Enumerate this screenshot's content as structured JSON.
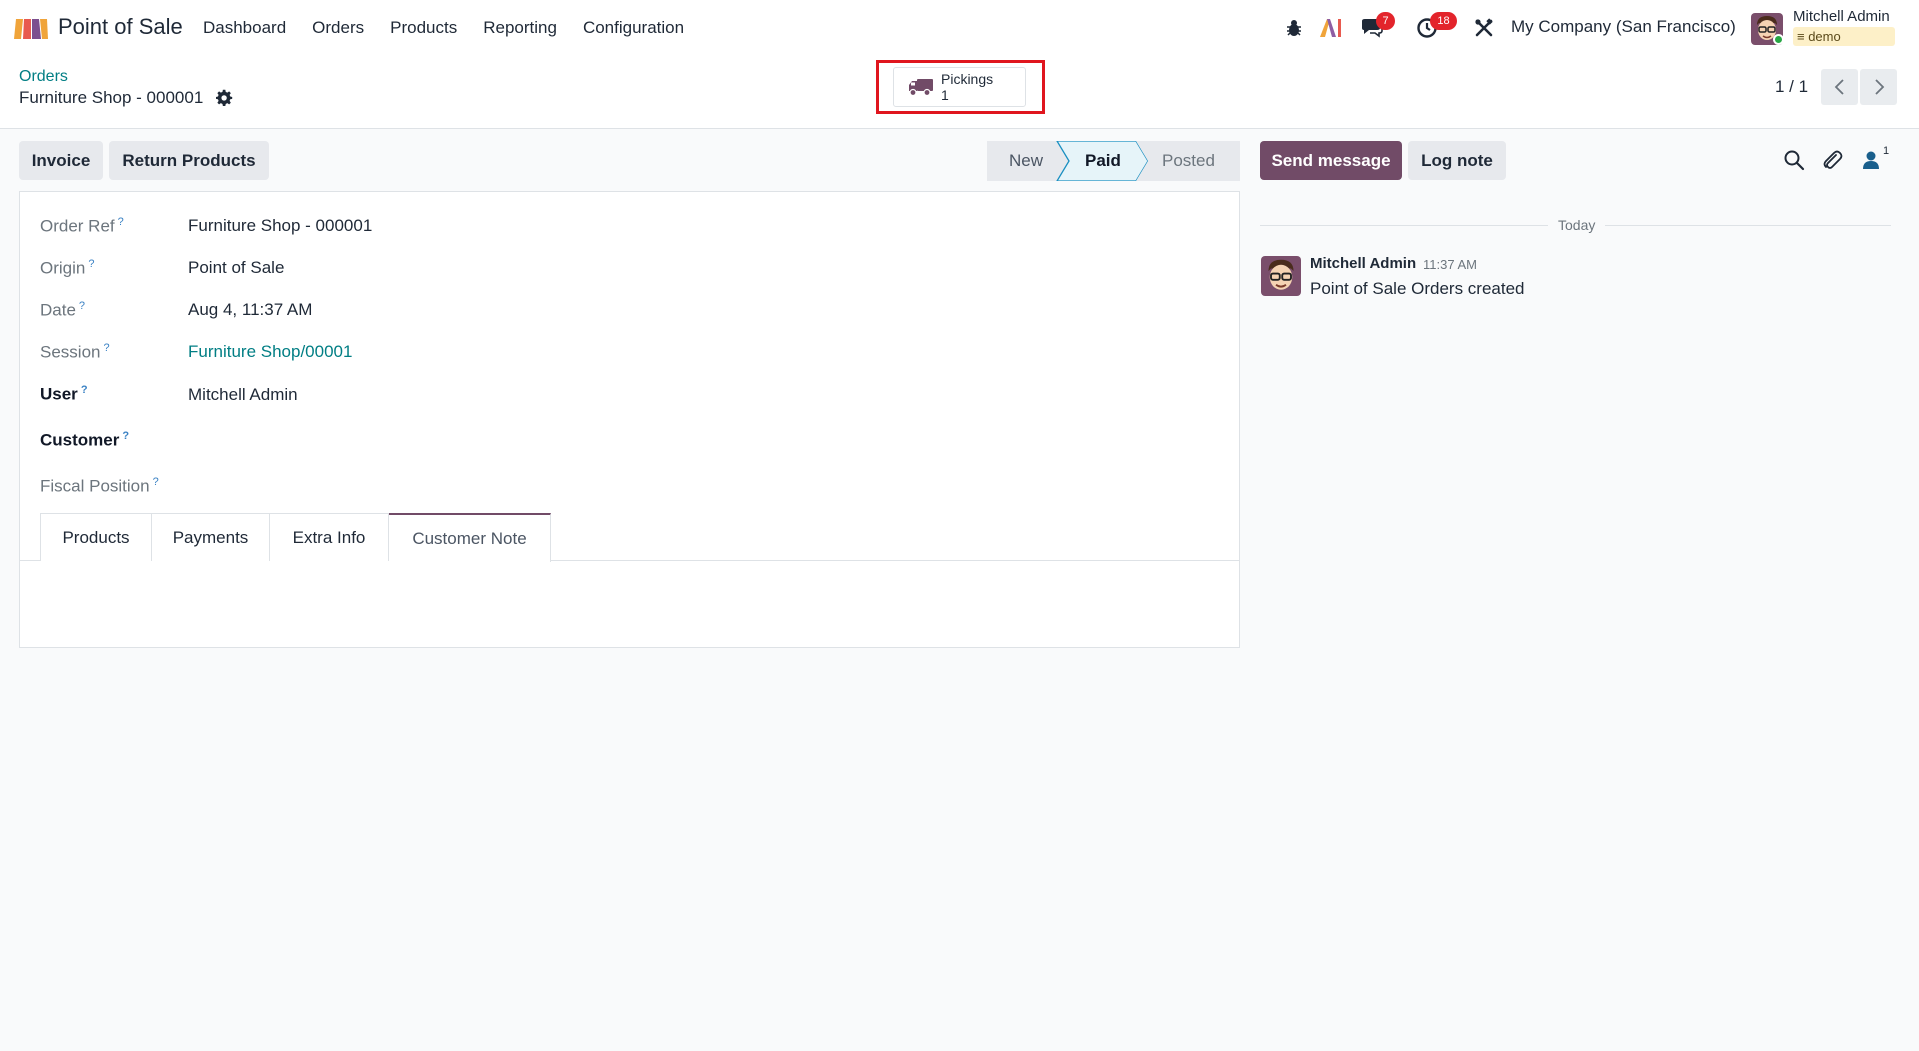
{
  "navbar": {
    "app_name": "Point of Sale",
    "menu": [
      "Dashboard",
      "Orders",
      "Products",
      "Reporting",
      "Configuration"
    ],
    "messages_count": "7",
    "activities_count": "18",
    "company": "My Company (San Francisco)",
    "user_name": "Mitchell Admin",
    "database": "demo"
  },
  "control_panel": {
    "breadcrumb": "Orders",
    "record_title": "Furniture Shop - 000001",
    "smart_button": {
      "label": "Pickings",
      "count": "1"
    },
    "pager": "1 / 1"
  },
  "actions": {
    "invoice": "Invoice",
    "return_products": "Return Products"
  },
  "status": {
    "stages": [
      "New",
      "Paid",
      "Posted"
    ],
    "current": "Paid"
  },
  "form": {
    "fields": [
      {
        "label": "Order Ref",
        "value": "Furniture Shop - 000001"
      },
      {
        "label": "Origin",
        "value": "Point of Sale"
      },
      {
        "label": "Date",
        "value": "Aug 4, 11:37 AM"
      },
      {
        "label": "Session",
        "value": "Furniture Shop/00001"
      },
      {
        "label": "User",
        "value": "Mitchell Admin"
      },
      {
        "label": "Customer",
        "value": ""
      },
      {
        "label": "Fiscal Position",
        "value": ""
      }
    ],
    "help_mark": "?",
    "tabs": [
      "Products",
      "Payments",
      "Extra Info",
      "Customer Note"
    ],
    "active_tab": "Customer Note"
  },
  "chatter": {
    "send_message": "Send message",
    "log_note": "Log note",
    "followers_count": "1",
    "date_separator": "Today",
    "messages": [
      {
        "author": "Mitchell Admin",
        "time": "11:37 AM",
        "body": "Point of Sale Orders created"
      }
    ]
  },
  "colors": {
    "brand": "#714b67",
    "link": "#017e84",
    "badge": "#e3242b",
    "highlight": "#e0161e",
    "status_active": "#1a8fc1"
  },
  "icons": [
    "app-logo-icon",
    "bug-icon",
    "ai-icon",
    "chat-icon",
    "clock-icon",
    "tools-icon",
    "gear-icon",
    "truck-icon",
    "chevron-left-icon",
    "chevron-right-icon",
    "search-icon",
    "paperclip-icon",
    "user-icon"
  ]
}
